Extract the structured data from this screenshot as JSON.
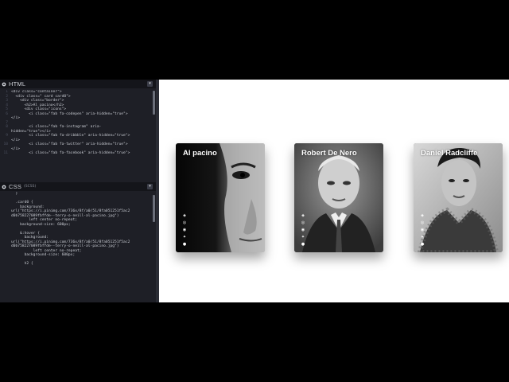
{
  "html_panel": {
    "title": "HTML",
    "lines": [
      {
        "n": "1",
        "code": "<div class=\"container\">"
      },
      {
        "n": "2",
        "code": "  <div class=\" card card0\">"
      },
      {
        "n": "3",
        "code": "    <div class=\"border\">"
      },
      {
        "n": "4",
        "code": "      <h2>Al pacino</h2>"
      },
      {
        "n": "5",
        "code": "      <div class=\"icons\">"
      },
      {
        "n": "6",
        "code": "        <i class=\"fab fa-codepen\" aria-hidden=\"true\">"
      },
      {
        "n": "",
        "code": "</i>"
      },
      {
        "n": "7",
        "code": ""
      },
      {
        "n": "8",
        "code": "        <i class=\"fab fa-instagram\" aria-"
      },
      {
        "n": "",
        "code": "hidden=\"true\"></i>"
      },
      {
        "n": "9",
        "code": "        <i class=\"fab fa-dribbble\" aria-hidden=\"true\">"
      },
      {
        "n": "",
        "code": "</i>"
      },
      {
        "n": "10",
        "code": "        <i class=\"fab fa-twitter\" aria-hidden=\"true\">"
      },
      {
        "n": "",
        "code": "</i>"
      },
      {
        "n": "11",
        "code": "        <i class=\"fab fa-facebook\" aria-hidden=\"true\">"
      }
    ]
  },
  "css_panel": {
    "title": "CSS",
    "subtitle": "(SCSS)",
    "lines": [
      {
        "n": "",
        "code": "  }"
      },
      {
        "n": "",
        "code": ""
      },
      {
        "n": "",
        "code": "  .card0 {"
      },
      {
        "n": "",
        "code": "    background:"
      },
      {
        "n": "",
        "code": "url(\"https://i.pinimg.com/736x/8f/a0/51/8fa051251f5ac2"
      },
      {
        "n": "",
        "code": "d0b758227089fbffde--terry-o-neill-al-pacino.jpg\")"
      },
      {
        "n": "",
        "code": "        left center no-repeat;"
      },
      {
        "n": "",
        "code": "    background-size: 600px;"
      },
      {
        "n": "",
        "code": ""
      },
      {
        "n": "",
        "code": "    &:hover {"
      },
      {
        "n": "",
        "code": "      background:"
      },
      {
        "n": "",
        "code": "url(\"https://i.pinimg.com/736x/8f/a0/51/8fa051251f5ac2"
      },
      {
        "n": "",
        "code": "d0b758227089fbffde--terry-o-neill-al-pacino.jpg\")"
      },
      {
        "n": "",
        "code": "          left center no-repeat;"
      },
      {
        "n": "",
        "code": "      background-size: 600px;"
      },
      {
        "n": "",
        "code": ""
      },
      {
        "n": "",
        "code": "      h2 {"
      }
    ]
  },
  "cards": [
    {
      "name": "Al pacino"
    },
    {
      "name": "Robert De Nero"
    },
    {
      "name": "Daniel Radcliffe"
    }
  ],
  "icons": [
    "codepen-icon",
    "instagram-icon",
    "dribbble-icon",
    "twitter-icon",
    "facebook-icon"
  ],
  "colors": {
    "accent": "#f0a030",
    "editor_bg": "#1e1f26",
    "preview_bg": "#ffffff"
  }
}
